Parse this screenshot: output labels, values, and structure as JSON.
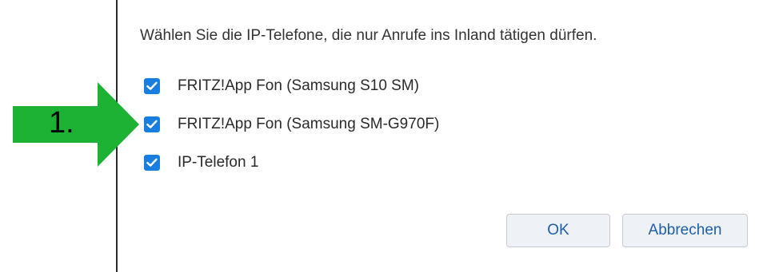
{
  "dialog": {
    "instruction": "Wählen Sie die IP-Telefone, die nur Anrufe ins Inland tätigen dürfen.",
    "options": [
      {
        "label": "FRITZ!App Fon (Samsung S10 SM)",
        "checked": true
      },
      {
        "label": "FRITZ!App Fon (Samsung SM-G970F)",
        "checked": true
      },
      {
        "label": "IP-Telefon 1",
        "checked": true
      }
    ],
    "buttons": {
      "ok_label": "OK",
      "cancel_label": "Abbrechen"
    }
  },
  "annotation": {
    "step_label": "1.",
    "arrow_color": "#1db233"
  },
  "colors": {
    "checkbox_accent": "#1a7ee0",
    "button_text": "#1f5fa8",
    "button_bg": "#eef1f5"
  },
  "icons": {
    "checkbox": "checkmark-icon",
    "annotation": "right-arrow-icon"
  }
}
